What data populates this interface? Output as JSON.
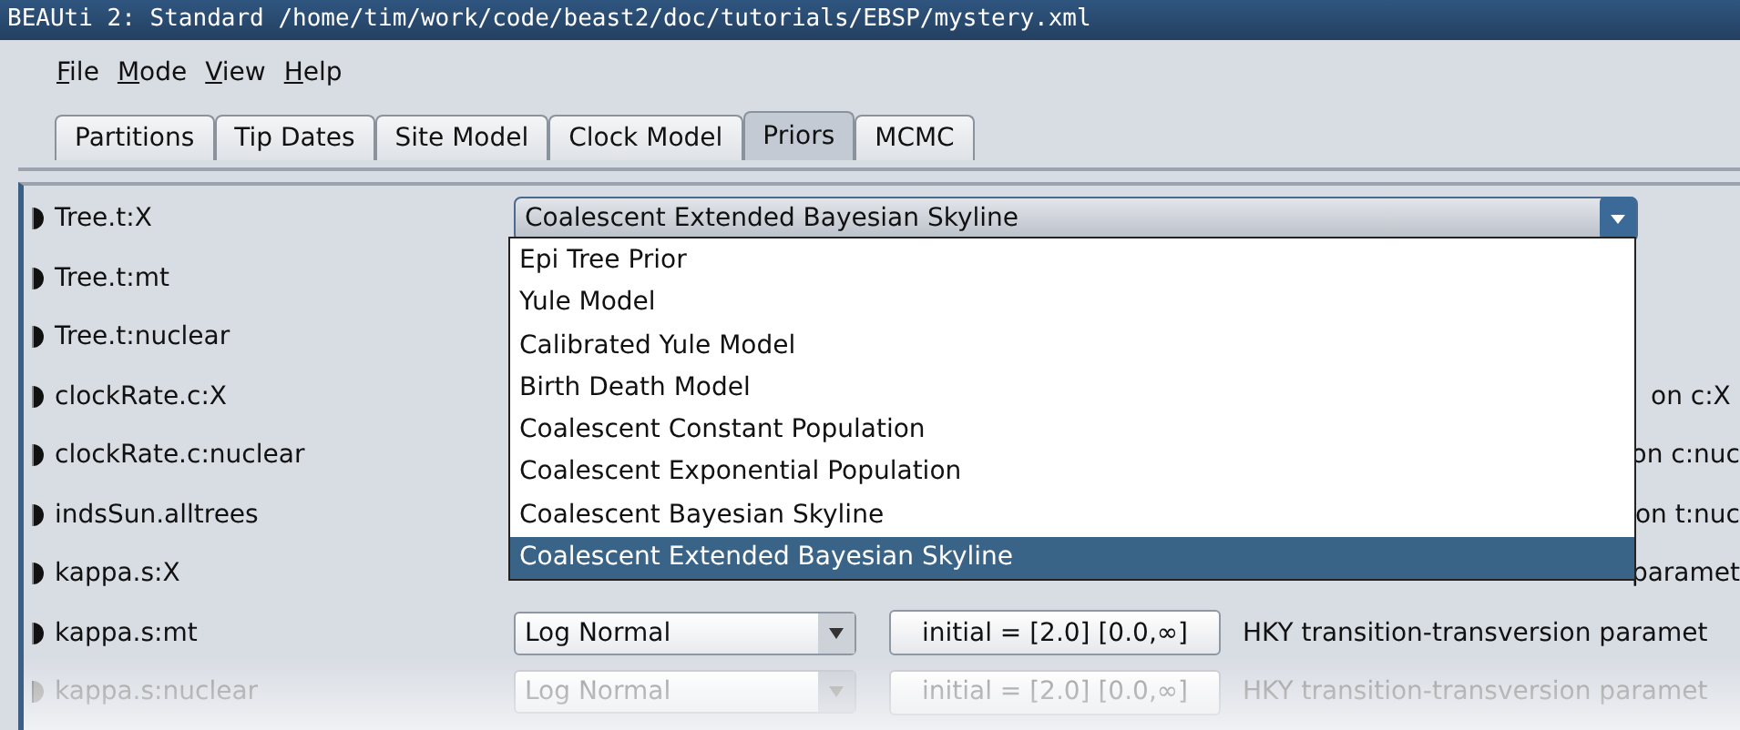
{
  "window": {
    "title": "BEAUti 2: Standard /home/tim/work/code/beast2/doc/tutorials/EBSP/mystery.xml"
  },
  "menu": [
    {
      "label": "File"
    },
    {
      "label": "Mode"
    },
    {
      "label": "View"
    },
    {
      "label": "Help"
    }
  ],
  "tabs": [
    {
      "label": "Partitions",
      "selected": false
    },
    {
      "label": "Tip Dates",
      "selected": false
    },
    {
      "label": "Site Model",
      "selected": false
    },
    {
      "label": "Clock Model",
      "selected": false
    },
    {
      "label": "Priors",
      "selected": true
    },
    {
      "label": "MCMC",
      "selected": false
    }
  ],
  "priors": [
    {
      "kind": "open",
      "name": "Tree.t:X",
      "prior": "Coalescent Extended Bayesian Skyline"
    },
    {
      "kind": "covered",
      "name": "Tree.t:mt"
    },
    {
      "kind": "covered",
      "name": "Tree.t:nuclear"
    },
    {
      "kind": "covered",
      "name": "clockRate.c:X",
      "description": "on c:X"
    },
    {
      "kind": "covered",
      "name": "clockRate.c:nuclear",
      "description": "on c:nuc"
    },
    {
      "kind": "covered",
      "name": "indsSun.alltrees",
      "description": "on t:nuc"
    },
    {
      "kind": "covered",
      "name": "kappa.s:X",
      "description": "paramet"
    },
    {
      "kind": "full",
      "name": "kappa.s:mt",
      "prior": "Log Normal",
      "initial": "initial = [2.0] [0.0,∞]",
      "description": "HKY transition-transversion paramet",
      "disabled": false
    },
    {
      "kind": "full",
      "name": "kappa.s:nuclear",
      "prior": "Log Normal",
      "initial": "initial = [2.0] [0.0,∞]",
      "description": "HKY transition-transversion paramet",
      "disabled": true
    }
  ],
  "dropdown": {
    "options": [
      {
        "label": "Epi Tree Prior",
        "selected": false
      },
      {
        "label": "Yule Model",
        "selected": false
      },
      {
        "label": "Calibrated Yule Model",
        "selected": false
      },
      {
        "label": "Birth Death Model",
        "selected": false
      },
      {
        "label": "Coalescent Constant Population",
        "selected": false
      },
      {
        "label": "Coalescent Exponential Population",
        "selected": false
      },
      {
        "label": "Coalescent Bayesian Skyline",
        "selected": false
      },
      {
        "label": "Coalescent Extended Bayesian Skyline",
        "selected": true
      }
    ]
  }
}
